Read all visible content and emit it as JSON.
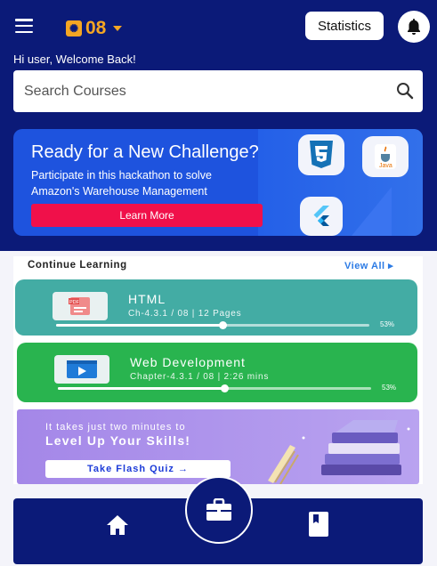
{
  "header": {
    "coins": "08",
    "statistics_label": "Statistics",
    "welcome": "Hi user, Welcome Back!"
  },
  "search": {
    "placeholder": "Search Courses"
  },
  "banner": {
    "title": "Ready for a New Challenge?",
    "subtitle": "Participate in this hackathon to solve Amazon's Warehouse Management",
    "button": "Learn More",
    "logo_text_java": "Java"
  },
  "continue": {
    "title": "Continue Learning",
    "view_all": "View All ▸",
    "courses": [
      {
        "title": "HTML",
        "meta": "Ch-4.3.1 / 08  | 12 Pages",
        "percent_label": "53%",
        "progress": 0.53,
        "color": "#43aca4",
        "icon": "pdf-icon"
      },
      {
        "title": "Web Development",
        "meta": "Chapter-4.3.1 / 08  | 2:26 mins",
        "percent_label": "53%",
        "progress": 0.53,
        "color": "#29b44f",
        "icon": "video-icon"
      }
    ]
  },
  "quiz": {
    "line1": "It takes just two minutes to",
    "line2": "Level Up Your Skills!",
    "button": "Take Flash Quiz  →"
  },
  "colors": {
    "navy": "#0b1a78",
    "accent": "#f0104a",
    "coin": "#f5a623"
  },
  "nav": {
    "items": [
      "home-icon",
      "briefcase-icon",
      "book-icon"
    ]
  }
}
